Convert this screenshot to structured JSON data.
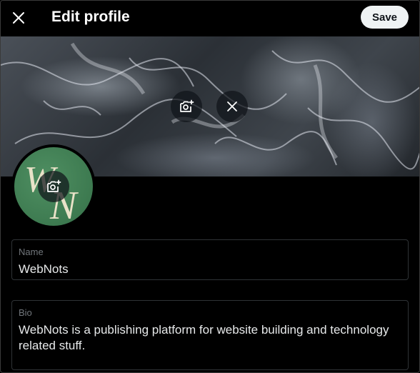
{
  "header": {
    "title": "Edit profile",
    "save_label": "Save"
  },
  "icons": {
    "close": "close-icon",
    "banner_camera": "add-photo-icon",
    "banner_remove": "remove-photo-icon",
    "avatar_camera": "add-photo-icon"
  },
  "avatar": {
    "logo_text_1": "W",
    "logo_text_2": "N"
  },
  "form": {
    "name": {
      "label": "Name",
      "value": "WebNots"
    },
    "bio": {
      "label": "Bio",
      "value": "WebNots is a publishing platform for website building and technology related stuff."
    }
  },
  "colors": {
    "background": "#000000",
    "save_button_bg": "#eff3f4",
    "field_border": "#2f3336",
    "label": "#71767b",
    "avatar_green": "#3d7a50"
  }
}
